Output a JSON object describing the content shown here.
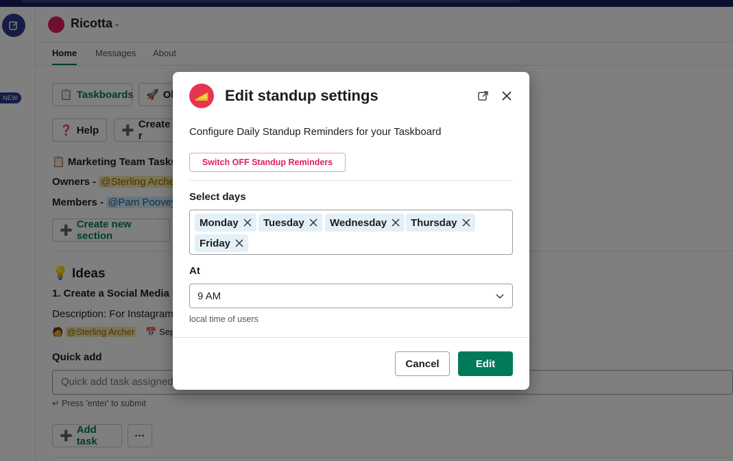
{
  "app": {
    "title": "Ricotta",
    "tabs": [
      {
        "label": "Home",
        "active": true
      },
      {
        "label": "Messages"
      },
      {
        "label": "About"
      }
    ],
    "new_badge": "NEW"
  },
  "background": {
    "taskboards_label": "Taskboards",
    "other_label": "Ol",
    "help_label": "Help",
    "create_label": "Create r",
    "board_title": "Marketing Team Tasks",
    "owners_label": "Owners - ",
    "owner_mention": "@Sterling Archer",
    "members_label": "Members - ",
    "member_mention": "@Pam Poovey",
    "create_section_label": "Create new section",
    "section_title": "Ideas",
    "task_title": "1. Create a Social Media ca",
    "task_description": "Description: For Instagram,",
    "task_assignee": "@Sterling Archer",
    "task_date": "Sep",
    "quick_add_label": "Quick add",
    "quick_add_placeholder": "Quick add task assigned",
    "enter_hint": "↵ Press 'enter' to submit",
    "add_task_label": "Add task",
    "more_label": "···"
  },
  "modal": {
    "title": "Edit standup settings",
    "description": "Configure Daily Standup Reminders for your Taskboard",
    "switch_off_label": "Switch OFF Standup Reminders",
    "select_days_label": "Select days",
    "days": [
      "Monday",
      "Tuesday",
      "Wednesday",
      "Thursday",
      "Friday"
    ],
    "at_label": "At",
    "time_value": "9 AM",
    "time_hint": "local time of users",
    "cancel_label": "Cancel",
    "edit_label": "Edit"
  },
  "colors": {
    "accent_green": "#007a5a",
    "danger_pink": "#e01e5a",
    "chip_bg": "#e3f0f7"
  }
}
